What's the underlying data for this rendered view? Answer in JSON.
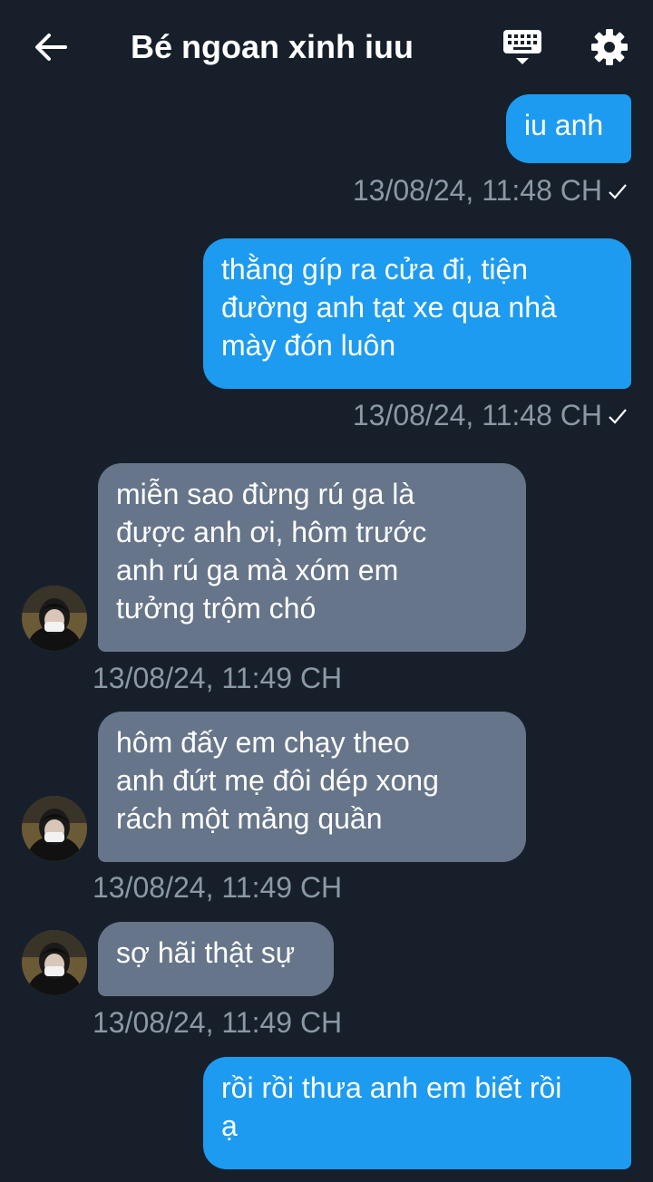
{
  "header": {
    "title": "Bé ngoan xinh iuu",
    "back_icon": "arrow-left-icon",
    "keyboard_icon": "keyboard-icon",
    "settings_icon": "gear-icon"
  },
  "colors": {
    "background": "#17202a",
    "sent_bubble": "#1d9bf0",
    "received_bubble": "#66758a",
    "timestamp": "#8b98a5"
  },
  "messages": [
    {
      "direction": "sent",
      "lines": [
        "iu anh"
      ],
      "timestamp": "13/08/24, 11:48 CH",
      "status_icon": "check-icon"
    },
    {
      "direction": "sent",
      "lines": [
        "thằng gíp ra cửa đi, tiện",
        "đường anh tạt xe qua nhà",
        "mày đón luôn"
      ],
      "timestamp": "13/08/24, 11:48 CH",
      "status_icon": "check-icon"
    },
    {
      "direction": "received",
      "lines": [
        "miễn sao đừng rú ga là",
        "được anh ơi, hôm trước",
        "anh rú ga mà xóm em",
        "tưởng trộm chó"
      ],
      "timestamp": "13/08/24, 11:49 CH"
    },
    {
      "direction": "received",
      "lines": [
        "hôm đấy em chạy theo",
        "anh đứt mẹ đôi dép xong",
        "rách một mảng quần"
      ],
      "timestamp": "13/08/24, 11:49 CH"
    },
    {
      "direction": "received",
      "lines": [
        "sợ hãi thật sự"
      ],
      "timestamp": "13/08/24, 11:49 CH"
    },
    {
      "direction": "sent",
      "lines": [
        "rồi rồi thưa anh em biết rồi",
        "ạ"
      ]
    }
  ]
}
